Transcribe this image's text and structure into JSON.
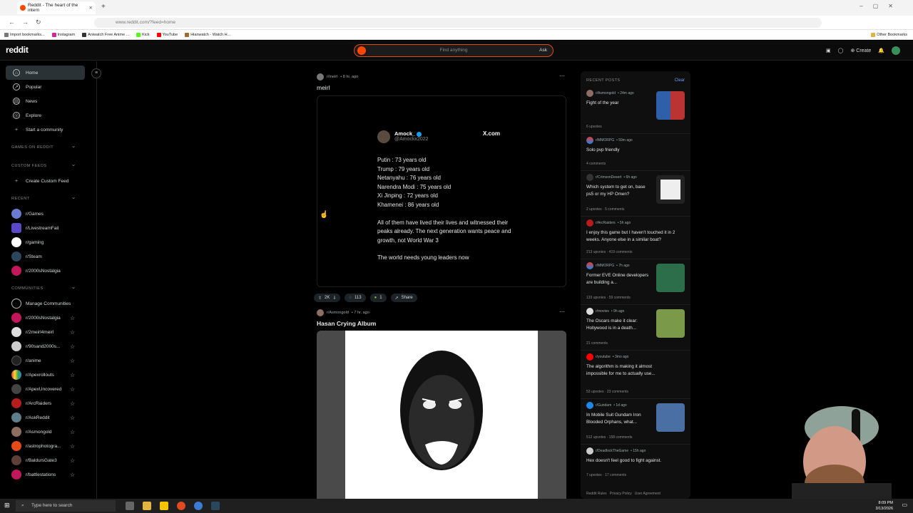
{
  "browser": {
    "tab_title": "Reddit - The heart of the intern",
    "url": "www.reddit.com/?feed=home",
    "bookmarks": [
      "Import bookmarks...",
      "Instagram",
      "Aniwatch Free Anime ...",
      "Kick",
      "YouTube",
      "Hianwatch - Watch H..."
    ],
    "other_bookmarks": "Other Bookmarks"
  },
  "header": {
    "logo": "reddit",
    "search_placeholder": "Find anything",
    "ask": "Ask",
    "create": "Create"
  },
  "sidebar": {
    "nav": [
      "Home",
      "Popular",
      "News",
      "Explore",
      "Start a community"
    ],
    "games_heading": "GAMES ON REDDIT",
    "custom_heading": "CUSTOM FEEDS",
    "create_custom": "Create Custom Feed",
    "recent_heading": "RECENT",
    "recent": [
      "r/Games",
      "r/LivestreamFail",
      "r/gaming",
      "r/Steam",
      "r/2000sNostalgia"
    ],
    "communities_heading": "COMMUNITIES",
    "manage": "Manage Communities",
    "communities": [
      "r/2000sNostalgia",
      "r/2meirl4meirl",
      "r/90sand2000s...",
      "r/anime",
      "r/Apexrollouts",
      "r/ApexUncovered",
      "r/ArcRaiders",
      "r/AskReddit",
      "r/Asmongold",
      "r/astrophotogra...",
      "r/BaldursGate3",
      "r/battlestations"
    ]
  },
  "feed": {
    "post1": {
      "sub": "r/meirl",
      "age": "• 8 hr. ago",
      "title": "meirl",
      "tweet": {
        "name": "Amock_",
        "handle": "@Amockx2022",
        "brand": "X.com",
        "list": [
          "Putin : 73 years old",
          "Trump : 79 years old",
          "Netanyahu : 76 years old",
          "Narendra Modi : 75 years old",
          "Xi Jinping : 72 years old",
          "Khamenei : 86 years old"
        ],
        "para": "All of them have lived their lives and witnessed their peaks already. The next generation wants peace and growth, not World War 3",
        "closing": "The world needs young leaders now"
      },
      "votes": "2K",
      "comments": "113",
      "awards": "1",
      "share": "Share"
    },
    "post2": {
      "sub": "r/Asmongold",
      "age": "• 7 hr. ago",
      "title": "Hasan Crying Album"
    }
  },
  "recent_posts": {
    "heading": "RECENT POSTS",
    "clear": "Clear",
    "items": [
      {
        "sub": "r/Asmongold",
        "age": "• 24m ago",
        "title": "Fight of the year",
        "stats": "6 upvotes"
      },
      {
        "sub": "r/MMORPG",
        "age": "• 59m ago",
        "title": "Solo pvp friendly",
        "stats": "4 comments"
      },
      {
        "sub": "r/CrimsonDesert",
        "age": "• 6h ago",
        "title": "Which system to get on, base ps5 or my HP Omen?",
        "stats": "2 upvotes · 5 comments"
      },
      {
        "sub": "r/ArcRaiders",
        "age": "• 5h ago",
        "title": "I enjoy this game but I haven't touched it in 2 weeks. Anyone else in a similar boat?",
        "stats": "213 upvotes · 419 comments"
      },
      {
        "sub": "r/MMORPG",
        "age": "• 7h ago",
        "title": "Former EVE Online developers are building a...",
        "stats": "133 upvotes · 59 comments"
      },
      {
        "sub": "r/movies",
        "age": "• 9h ago",
        "title": "The Oscars make it clear: Hollywood is in a death...",
        "stats": "21 comments"
      },
      {
        "sub": "r/youtube",
        "age": "• 3mo ago",
        "title": "The algorithm is making it almost impossible for me to actually use...",
        "stats": "53 upvotes · 23 comments"
      },
      {
        "sub": "r/Gundam",
        "age": "• 1d ago",
        "title": "In Mobile Suit Gundam Iron Blooded Orphans, what...",
        "stats": "512 upvotes · 158 comments"
      },
      {
        "sub": "r/DeadlockTheGame",
        "age": "• 15h ago",
        "title": "Hex doesn't feel good to fight against.",
        "stats": "7 upvotes · 17 comments"
      }
    ],
    "footer": [
      "Reddit Rules",
      "Privacy Policy",
      "User Agreement"
    ]
  },
  "taskbar": {
    "search": "Type here to search",
    "time": "8:09 PM",
    "date": "3/13/2026"
  }
}
